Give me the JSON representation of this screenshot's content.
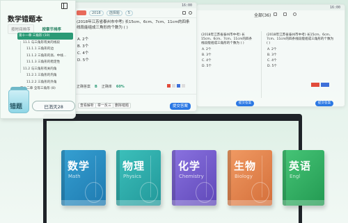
{
  "sidebar": {
    "title": "数学错题本",
    "tabs": [
      "按时间排序",
      "按章节排序"
    ],
    "tree": [
      {
        "label": "第十一章 三角形 (10)",
        "level": 1,
        "selected": true
      },
      {
        "label": "11.1 与三角形有关的线段",
        "level": 2
      },
      {
        "label": "11.1.1 三角形的边",
        "level": 3
      },
      {
        "label": "11.1.2 三角形的高、中线...",
        "level": 3
      },
      {
        "label": "11.1.3 三角形的稳定性",
        "level": 3
      },
      {
        "label": "11.2 与三角形有关的角",
        "level": 2
      },
      {
        "label": "11.2.1 三角形的内角",
        "level": 3
      },
      {
        "label": "11.2.2 三角形的外角",
        "level": 3
      },
      {
        "label": "第十二章 全等三角形 (8)",
        "level": 1
      }
    ],
    "jar_label": "错题",
    "eliminated": "已消灭28"
  },
  "panel_main": {
    "status_time": "16:00",
    "chips": [
      "2018",
      "选择题",
      "5"
    ],
    "question": "(2018年江苏省泰州市中考) 长15cm、6cm、7cm、11cm的四条线段能组成三角形的个数为 ( )",
    "options": [
      "A. 2个",
      "B. 3个",
      "C. 4个",
      "D. 5个"
    ],
    "answer_label": "正确答案",
    "answer_value": "B",
    "rate_label": "正确率",
    "rate_value": "60%",
    "btn_small": [
      "查看解析",
      "举一反三",
      "删除错题"
    ],
    "submit": "提交答案"
  },
  "panel_right": {
    "header": "全部(36)",
    "question": "(2018年江苏省泰州市中考) 长15cm、6cm、7cm、11cm的四条线段能组成三角形的个数为 ( )",
    "options": [
      "A. 2个",
      "B. 3个",
      "C. 4个",
      "D. 5个"
    ],
    "submit": "提交答案"
  },
  "books": [
    {
      "title": "数学",
      "subtitle": "Math",
      "color": "#2a8bbf"
    },
    {
      "title": "物理",
      "subtitle": "Physics",
      "color": "#2ba6a8"
    },
    {
      "title": "化学",
      "subtitle": "Chemistry",
      "color": "#6e58c8"
    },
    {
      "title": "生物",
      "subtitle": "Biology",
      "color": "#e07e4a"
    },
    {
      "title": "英语",
      "subtitle": "Engl",
      "color": "#2fae62"
    }
  ]
}
